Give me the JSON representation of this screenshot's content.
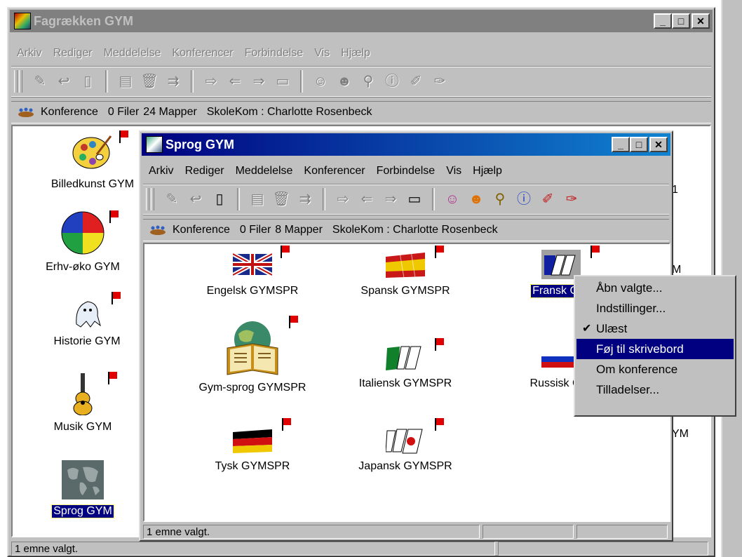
{
  "outer_window": {
    "title": "Fagrækken GYM",
    "menu": [
      "Arkiv",
      "Rediger",
      "Meddelelse",
      "Konferencer",
      "Forbindelse",
      "Vis",
      "Hjælp"
    ],
    "info": {
      "type": "Konference",
      "files": "0 Filer",
      "folders": "24 Mapper",
      "owner": "SkoleKom : Charlotte Rosenbeck"
    },
    "items": [
      {
        "label": "Billedkunst GYM",
        "icon": "palette-icon"
      },
      {
        "label": "Erhv-øko GYM",
        "icon": "pie-chart-icon"
      },
      {
        "label": "Historie GYM",
        "icon": "ghost-icon"
      },
      {
        "label": "Musik GYM",
        "icon": "guitar-icon"
      },
      {
        "label": "Sprog GYM",
        "icon": "world-map-icon"
      }
    ],
    "right_fragments": [
      "1",
      "M",
      "YM"
    ],
    "status": "1 emne valgt."
  },
  "inner_window": {
    "title": "Sprog GYM",
    "menu": [
      "Arkiv",
      "Rediger",
      "Meddelelse",
      "Konferencer",
      "Forbindelse",
      "Vis",
      "Hjælp"
    ],
    "info": {
      "type": "Konference",
      "files": "0 Filer",
      "folders": "8 Mapper",
      "owner": "SkoleKom : Charlotte Rosenbeck"
    },
    "items": [
      {
        "label": "Engelsk GYMSPR",
        "icon": "uk-flag-icon"
      },
      {
        "label": "Spansk GYMSPR",
        "icon": "spain-flag-icon"
      },
      {
        "label": "Fransk G",
        "icon": "france-flag-icon"
      },
      {
        "label": "Gym-sprog GYMSPR",
        "icon": "book-globe-icon"
      },
      {
        "label": "Italiensk GYMSPR",
        "icon": "italy-flag-icon"
      },
      {
        "label": "Russisk G",
        "icon": "russia-flag-icon"
      },
      {
        "label": "Tysk GYMSPR",
        "icon": "germany-flag-icon"
      },
      {
        "label": "Japansk GYMSPR",
        "icon": "japan-flag-icon"
      }
    ],
    "status": "1 emne valgt."
  },
  "context_menu": {
    "items": [
      {
        "label": "Åbn valgte...",
        "checked": false,
        "highlighted": false
      },
      {
        "label": "Indstillinger...",
        "checked": false,
        "highlighted": false
      },
      {
        "label": "Ulæst",
        "checked": true,
        "highlighted": false
      },
      {
        "label": "Føj til skrivebord",
        "checked": false,
        "highlighted": true
      },
      {
        "label": "Om konference",
        "checked": false,
        "highlighted": false
      },
      {
        "label": "Tilladelser...",
        "checked": false,
        "highlighted": false
      }
    ]
  },
  "window_buttons": {
    "minimize": "_",
    "maximize": "□",
    "close": "✕"
  },
  "checkmark": "✔",
  "colors": {
    "selection": "#000080",
    "titlebar_active": "#00007f",
    "titlebar_inactive": "#808080",
    "flag_red": "#e00000"
  }
}
